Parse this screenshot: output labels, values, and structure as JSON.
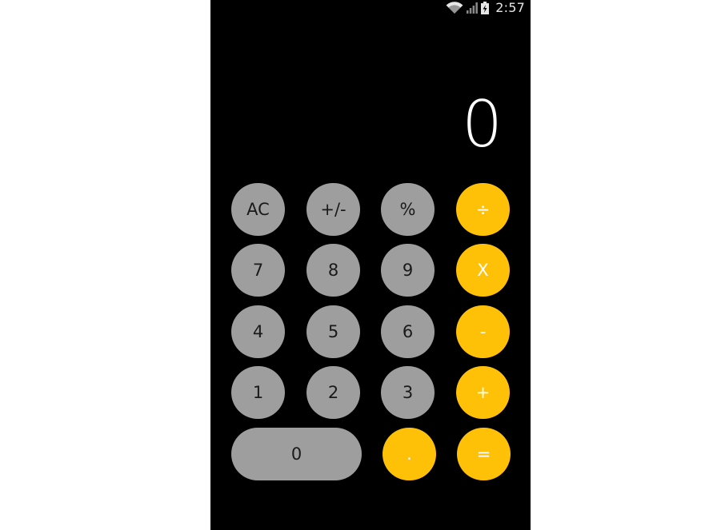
{
  "status_bar": {
    "time": "2:57",
    "icons": [
      "wifi-icon",
      "signal-icon",
      "battery-charging-icon"
    ]
  },
  "display": {
    "value": "0"
  },
  "keys": {
    "clear": "AC",
    "sign": "+/-",
    "percent": "%",
    "divide": "÷",
    "seven": "7",
    "eight": "8",
    "nine": "9",
    "multiply": "X",
    "four": "4",
    "five": "5",
    "six": "6",
    "minus": "-",
    "one": "1",
    "two": "2",
    "three": "3",
    "plus": "+",
    "zero": "0",
    "decimal": ".",
    "equals": "="
  },
  "colors": {
    "background": "#000000",
    "function_key": "#9e9e9e",
    "operator_key": "#ffc107",
    "display_text": "#ffffff"
  }
}
